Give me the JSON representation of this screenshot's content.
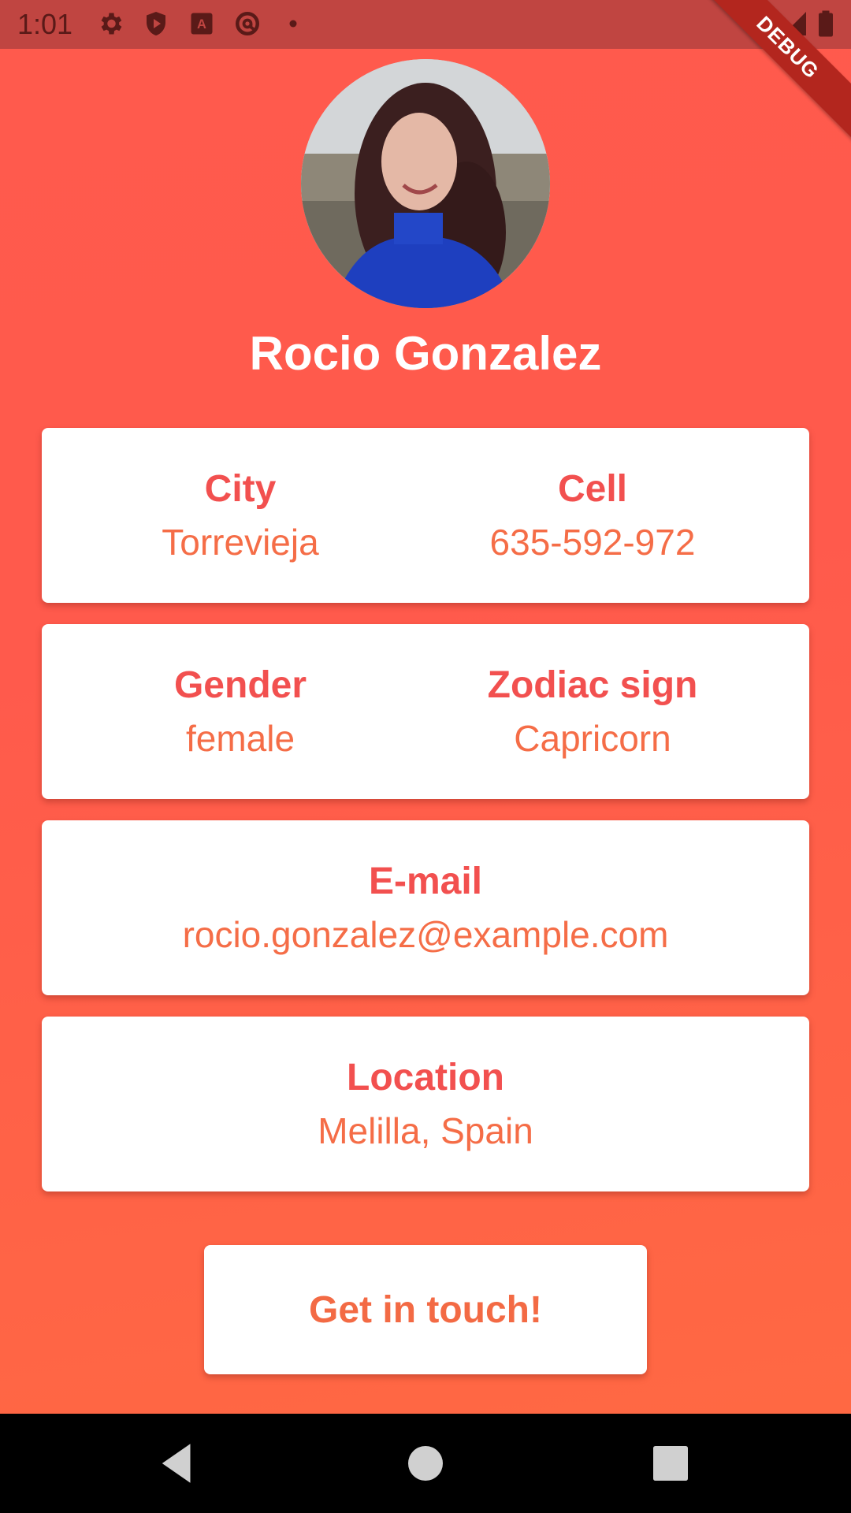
{
  "status_bar": {
    "time": "1:01",
    "icons": [
      "gear-icon",
      "shield-play-icon",
      "a-square-icon",
      "at-sign-icon",
      "dot-icon",
      "wifi-icon",
      "signal-icon",
      "battery-icon"
    ]
  },
  "debug_banner": "DEBUG",
  "profile": {
    "name": "Rocio Gonzalez"
  },
  "cards": {
    "city": {
      "label": "City",
      "value": "Torrevieja"
    },
    "cell": {
      "label": "Cell",
      "value": "635-592-972"
    },
    "gender": {
      "label": "Gender",
      "value": "female"
    },
    "zodiac": {
      "label": "Zodiac sign",
      "value": "Capricorn"
    },
    "email": {
      "label": "E-mail",
      "value": "rocio.gonzalez@example.com"
    },
    "location": {
      "label": "Location",
      "value": "Melilla, Spain"
    }
  },
  "button": {
    "label": "Get in touch!"
  },
  "colors": {
    "background_top": "#ff5a4d",
    "background_bottom": "#ff6a42",
    "label": "#f2504f",
    "value": "#f56d47",
    "status_bar": "#c04541"
  },
  "nav": [
    "back-icon",
    "home-icon",
    "recents-icon"
  ]
}
